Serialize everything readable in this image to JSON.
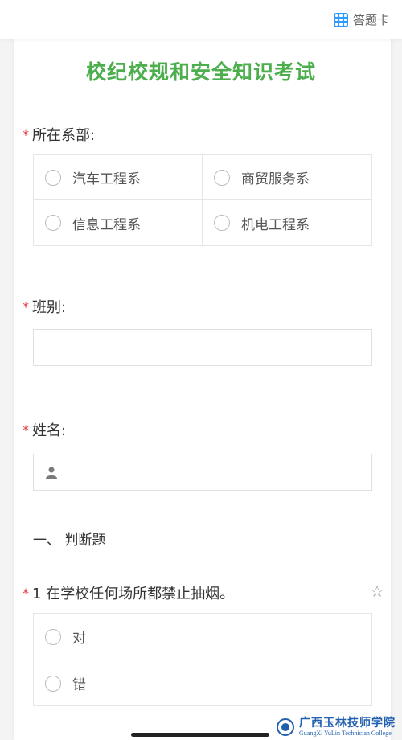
{
  "header": {
    "answer_card_label": "答题卡",
    "grid_icon": "grid-icon"
  },
  "title": "校纪校规和安全知识考试",
  "required_mark": "*",
  "fields": {
    "department": {
      "label": "所在系部:",
      "options": [
        "汽车工程系",
        "商贸服务系",
        "信息工程系",
        "机电工程系"
      ]
    },
    "class": {
      "label": "班别:",
      "value": ""
    },
    "name": {
      "label": "姓名:",
      "value": "",
      "icon": "user-icon"
    }
  },
  "section": {
    "heading": "一、 判断题"
  },
  "question1": {
    "text": "1 在学校任何场所都禁止抽烟。",
    "star_icon": "star-icon",
    "options": [
      "对",
      "错"
    ]
  },
  "footer": {
    "logo_cn": "广西玉林技师学院",
    "logo_en": "GuangXi YuLin Technician College"
  }
}
